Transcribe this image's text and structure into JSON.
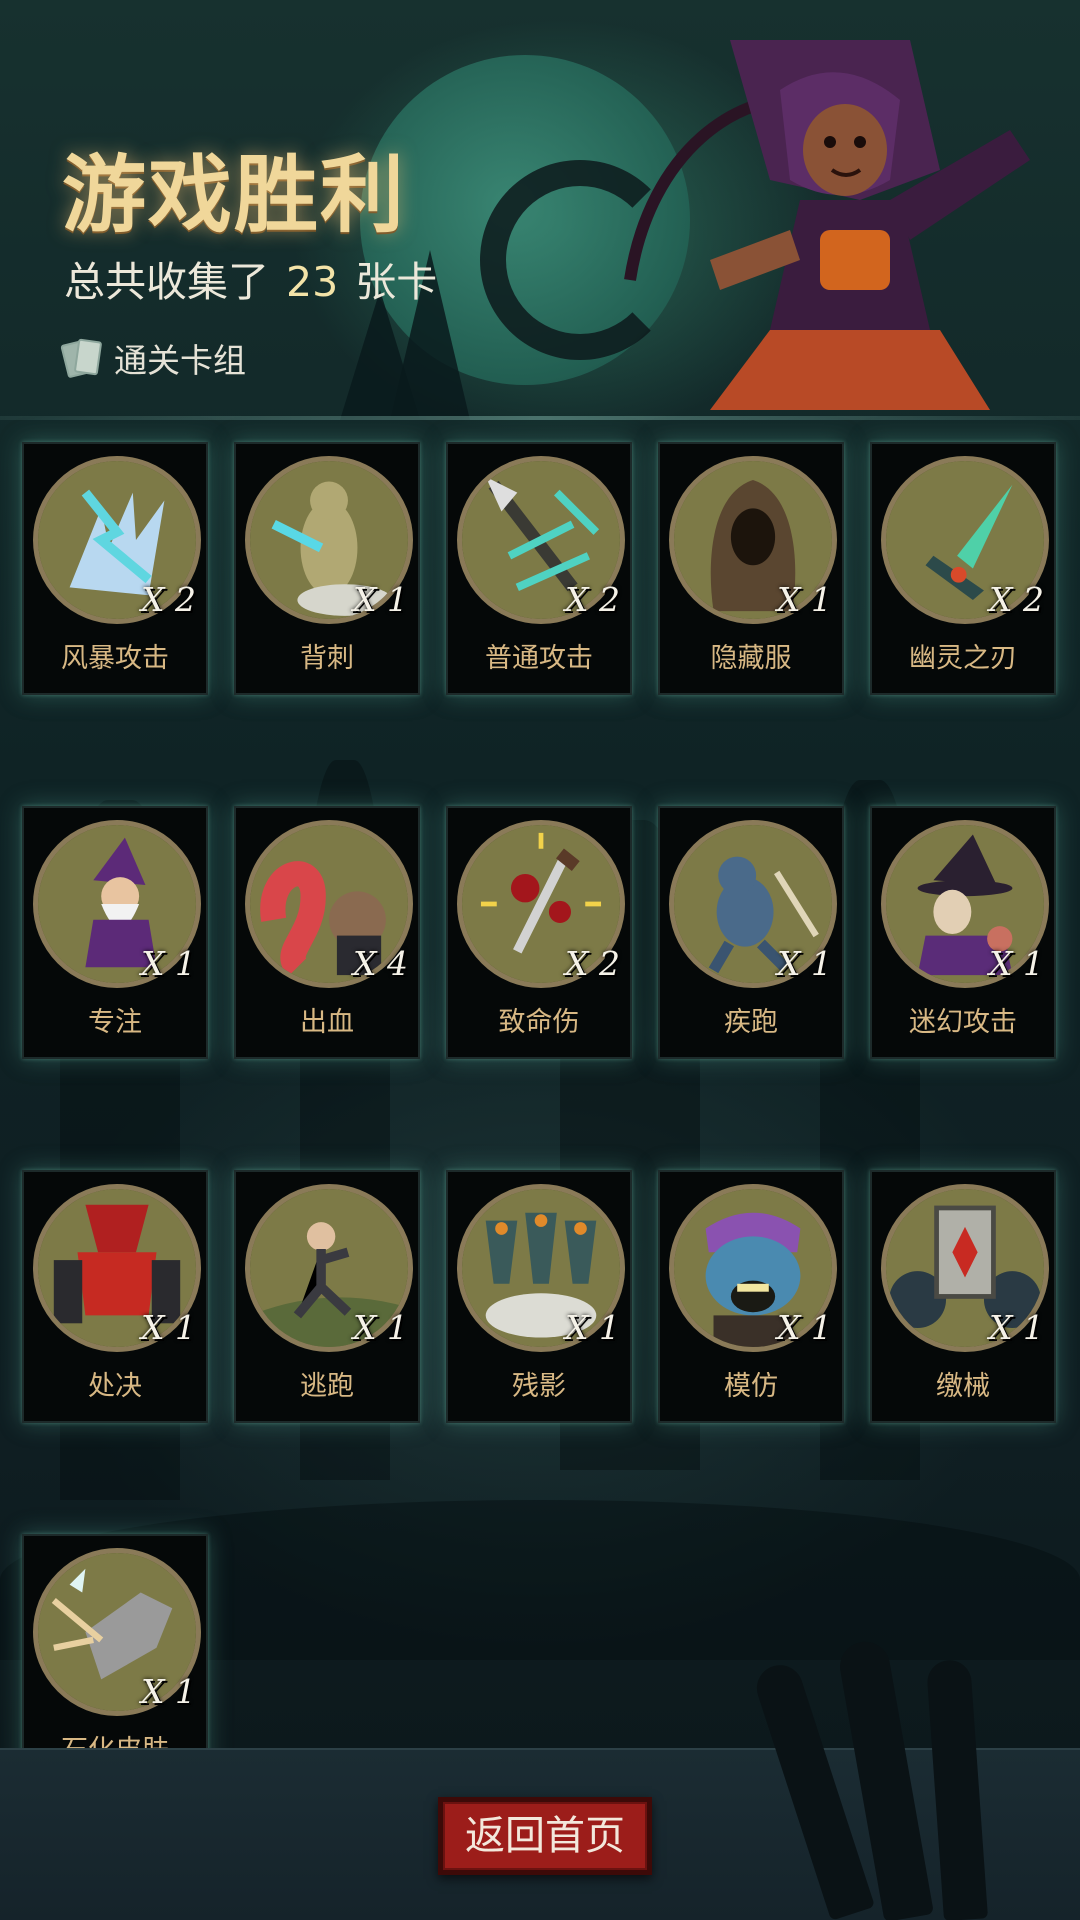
{
  "header": {
    "title": "游戏胜利",
    "collected_prefix": "总共收集了",
    "collected_count": "23",
    "collected_suffix": "张卡",
    "deck_label": "通关卡组"
  },
  "cards": [
    {
      "name": "风暴攻击",
      "count": "X 2",
      "icon": "storm-lightning"
    },
    {
      "name": "背刺",
      "count": "X 1",
      "icon": "backstab-dummy"
    },
    {
      "name": "普通攻击",
      "count": "X 2",
      "icon": "spear-strike"
    },
    {
      "name": "隐藏服",
      "count": "X 1",
      "icon": "hooded-cloak"
    },
    {
      "name": "幽灵之刃",
      "count": "X 2",
      "icon": "ghost-blade"
    },
    {
      "name": "专注",
      "count": "X 1",
      "icon": "wizard"
    },
    {
      "name": "出血",
      "count": "X 4",
      "icon": "tentacle-creature"
    },
    {
      "name": "致命伤",
      "count": "X 2",
      "icon": "bloody-dagger"
    },
    {
      "name": "疾跑",
      "count": "X 1",
      "icon": "running-beast"
    },
    {
      "name": "迷幻攻击",
      "count": "X 1",
      "icon": "witch"
    },
    {
      "name": "处决",
      "count": "X 1",
      "icon": "executioner"
    },
    {
      "name": "逃跑",
      "count": "X 1",
      "icon": "fleeing-man"
    },
    {
      "name": "残影",
      "count": "X 1",
      "icon": "shadow-clones"
    },
    {
      "name": "模仿",
      "count": "X 1",
      "icon": "goblin-face"
    },
    {
      "name": "缴械",
      "count": "X 1",
      "icon": "gear-card"
    },
    {
      "name": "石化皮肤",
      "count": "X 1",
      "icon": "stone-arm"
    }
  ],
  "footer": {
    "home_button": "返回首页"
  },
  "colors": {
    "title": "#f0d79a",
    "card_name": "#d8b884",
    "button": "#9c1d1a"
  }
}
